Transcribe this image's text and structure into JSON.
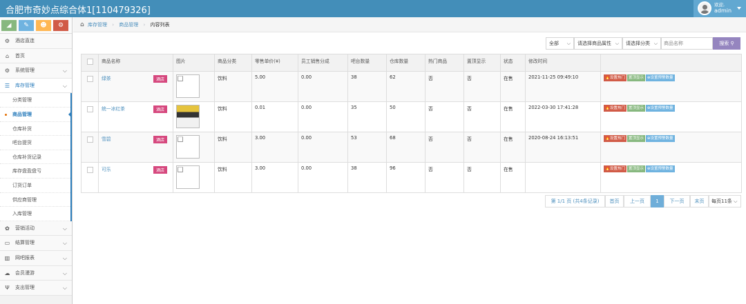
{
  "app": {
    "title": "合肥市奇妙点综合体1[110479326]"
  },
  "user": {
    "welcome": "欢迎,",
    "name": "admin"
  },
  "sidebar": {
    "shortcut_colors": [
      "#87b87f",
      "#6fb3e0",
      "#ffb752",
      "#d15b47"
    ],
    "items": [
      {
        "label": "酒店直连",
        "icon": "⚙",
        "arrow": ""
      },
      {
        "label": "首页",
        "icon": "⌂",
        "arrow": ""
      },
      {
        "label": "系统管理",
        "icon": "⚙",
        "arrow": "⌵"
      },
      {
        "label": "库存管理",
        "icon": "☰",
        "arrow": "⌵"
      }
    ],
    "subitems": [
      "分类管理",
      "商品管理",
      "仓库补货",
      "吧台提货",
      "仓库补货记录",
      "库存盘盈盘亏",
      "订货订单",
      "供应商管理",
      "入库管理"
    ],
    "bottom_items": [
      {
        "label": "营销活动",
        "icon": "✿",
        "arrow": "⌵"
      },
      {
        "label": "结算管理",
        "icon": "▭",
        "arrow": "⌵"
      },
      {
        "label": "网吧报表",
        "icon": "▥",
        "arrow": "⌵"
      },
      {
        "label": "会员漫游",
        "icon": "☁",
        "arrow": "⌵"
      },
      {
        "label": "支出管理",
        "icon": "Ψ",
        "arrow": "⌵"
      }
    ]
  },
  "breadcrumb": {
    "items": [
      "库存管理",
      "商品管理",
      "内容列表"
    ]
  },
  "filters": {
    "scope": "全部",
    "attribute": "请选择商品属性",
    "category": "请选择分类",
    "search_placeholder": "商品名称",
    "search_label": "搜索"
  },
  "table": {
    "headers": [
      "",
      "商品名称",
      "图片",
      "商品分类",
      "零售单价(¥)",
      "员工销售分成",
      "吧台数量",
      "仓库数量",
      "热门商品",
      "置顶显示",
      "状态",
      "修改时间",
      ""
    ],
    "rows": [
      {
        "name": "绿茶",
        "tag": "酒店",
        "category": "饮料",
        "price": "5.00",
        "commission": "0.00",
        "bar_qty": "38",
        "stock_qty": "62",
        "hot": "否",
        "top": "否",
        "status": "在售",
        "time": "2021-11-25 09:49:10"
      },
      {
        "name": "统一冰红茶",
        "tag": "酒店",
        "category": "饮料",
        "price": "0.01",
        "commission": "0.00",
        "bar_qty": "35",
        "stock_qty": "50",
        "hot": "否",
        "top": "否",
        "status": "在售",
        "time": "2022-03-30 17:41:28"
      },
      {
        "name": "雪碧",
        "tag": "酒店",
        "category": "饮料",
        "price": "3.00",
        "commission": "0.00",
        "bar_qty": "53",
        "stock_qty": "68",
        "hot": "否",
        "top": "否",
        "status": "在售",
        "time": "2020-08-24 16:13:51"
      },
      {
        "name": "可乐",
        "tag": "酒店",
        "category": "饮料",
        "price": "3.00",
        "commission": "0.00",
        "bar_qty": "38",
        "stock_qty": "96",
        "hot": "否",
        "top": "否",
        "status": "在售",
        "time": ""
      }
    ],
    "actions": {
      "hot": "设置热门",
      "top": "置顶显示",
      "stock": "设置预警数量"
    }
  },
  "pager": {
    "info": "第 1/1 页 (共4条记录)",
    "first": "首页",
    "prev": "上一页",
    "current": "1",
    "next": "下一页",
    "last": "末页",
    "per_page": "每页11条"
  }
}
